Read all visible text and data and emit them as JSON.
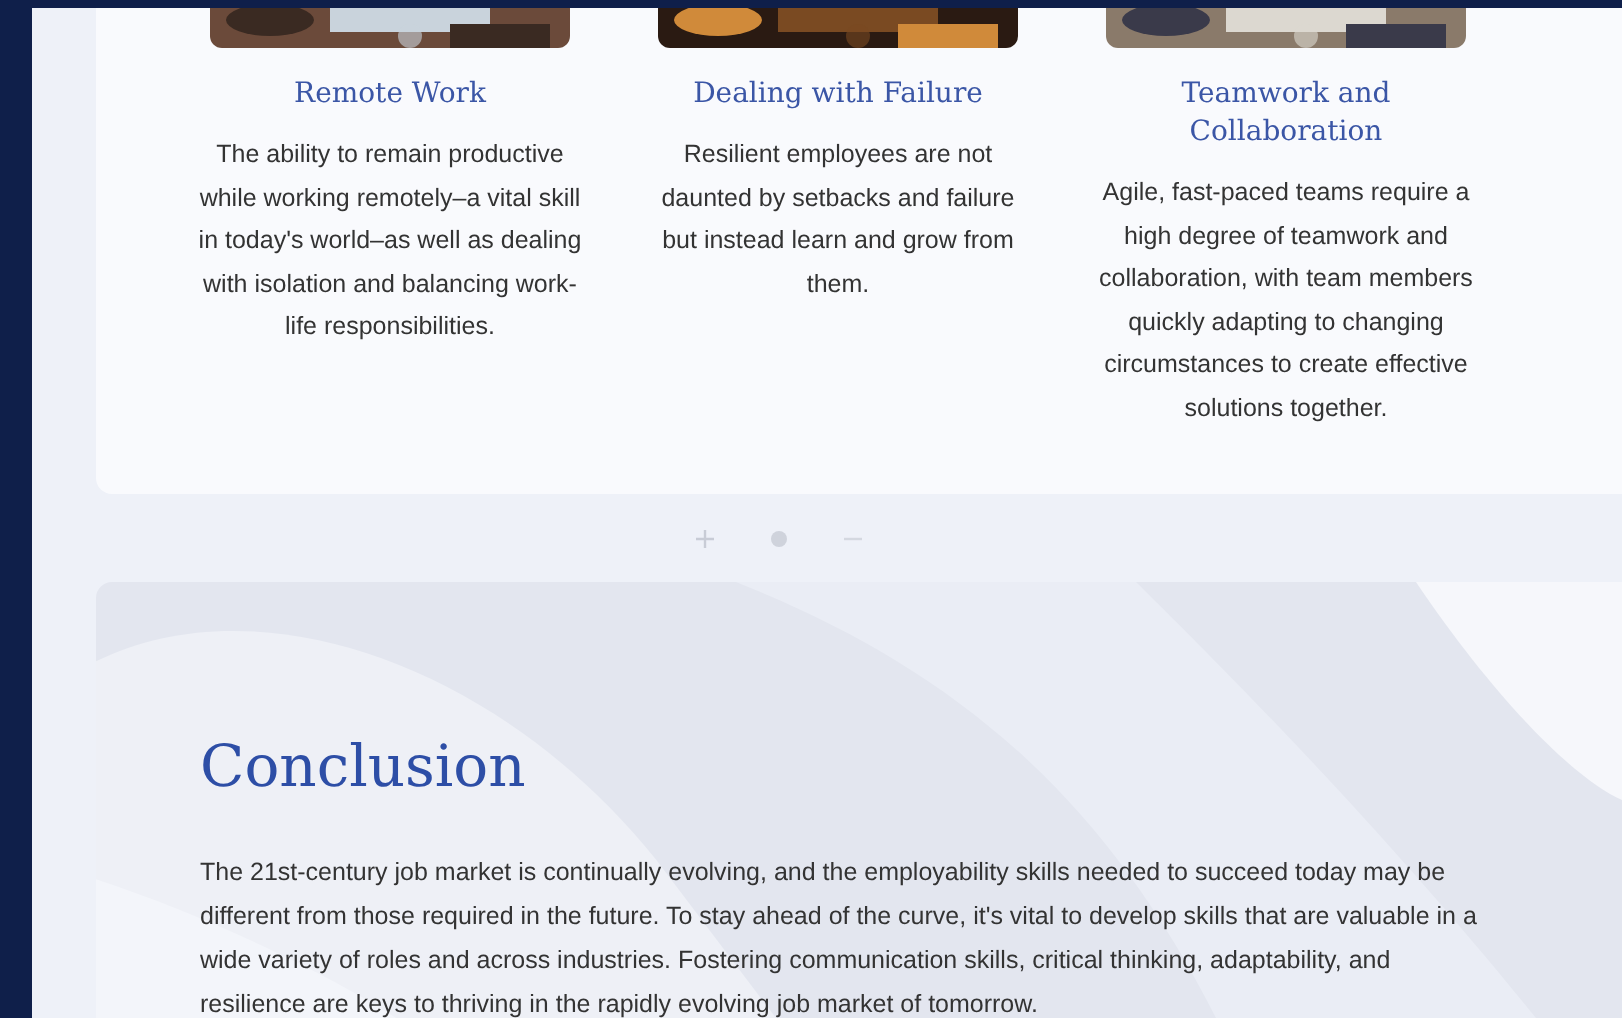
{
  "features": [
    {
      "title": "Remote Work",
      "text": "The ability to remain productive while working remotely–a vital skill in today's world–as well as dealing with isolation and balancing work-life responsibilities."
    },
    {
      "title": "Dealing with Failure",
      "text": "Resilient employees are not daunted by setbacks and failure but instead learn and grow from them."
    },
    {
      "title": "Teamwork and Collaboration",
      "text": "Agile, fast-paced teams require a high degree of teamwork and collaboration, with team members quickly adapting to changing circumstances to create effective solutions together."
    }
  ],
  "conclusion": {
    "heading": "Conclusion",
    "text": "The 21st-century job market is continually evolving, and the employability skills needed to succeed today may be different from those required in the future. To stay ahead of the curve, it's vital to develop skills that are valuable in a wide variety of roles and across industries. Fostering communication skills, critical thinking, adaptability, and resilience are keys to thriving in the rapidly evolving job market of tomorrow."
  }
}
